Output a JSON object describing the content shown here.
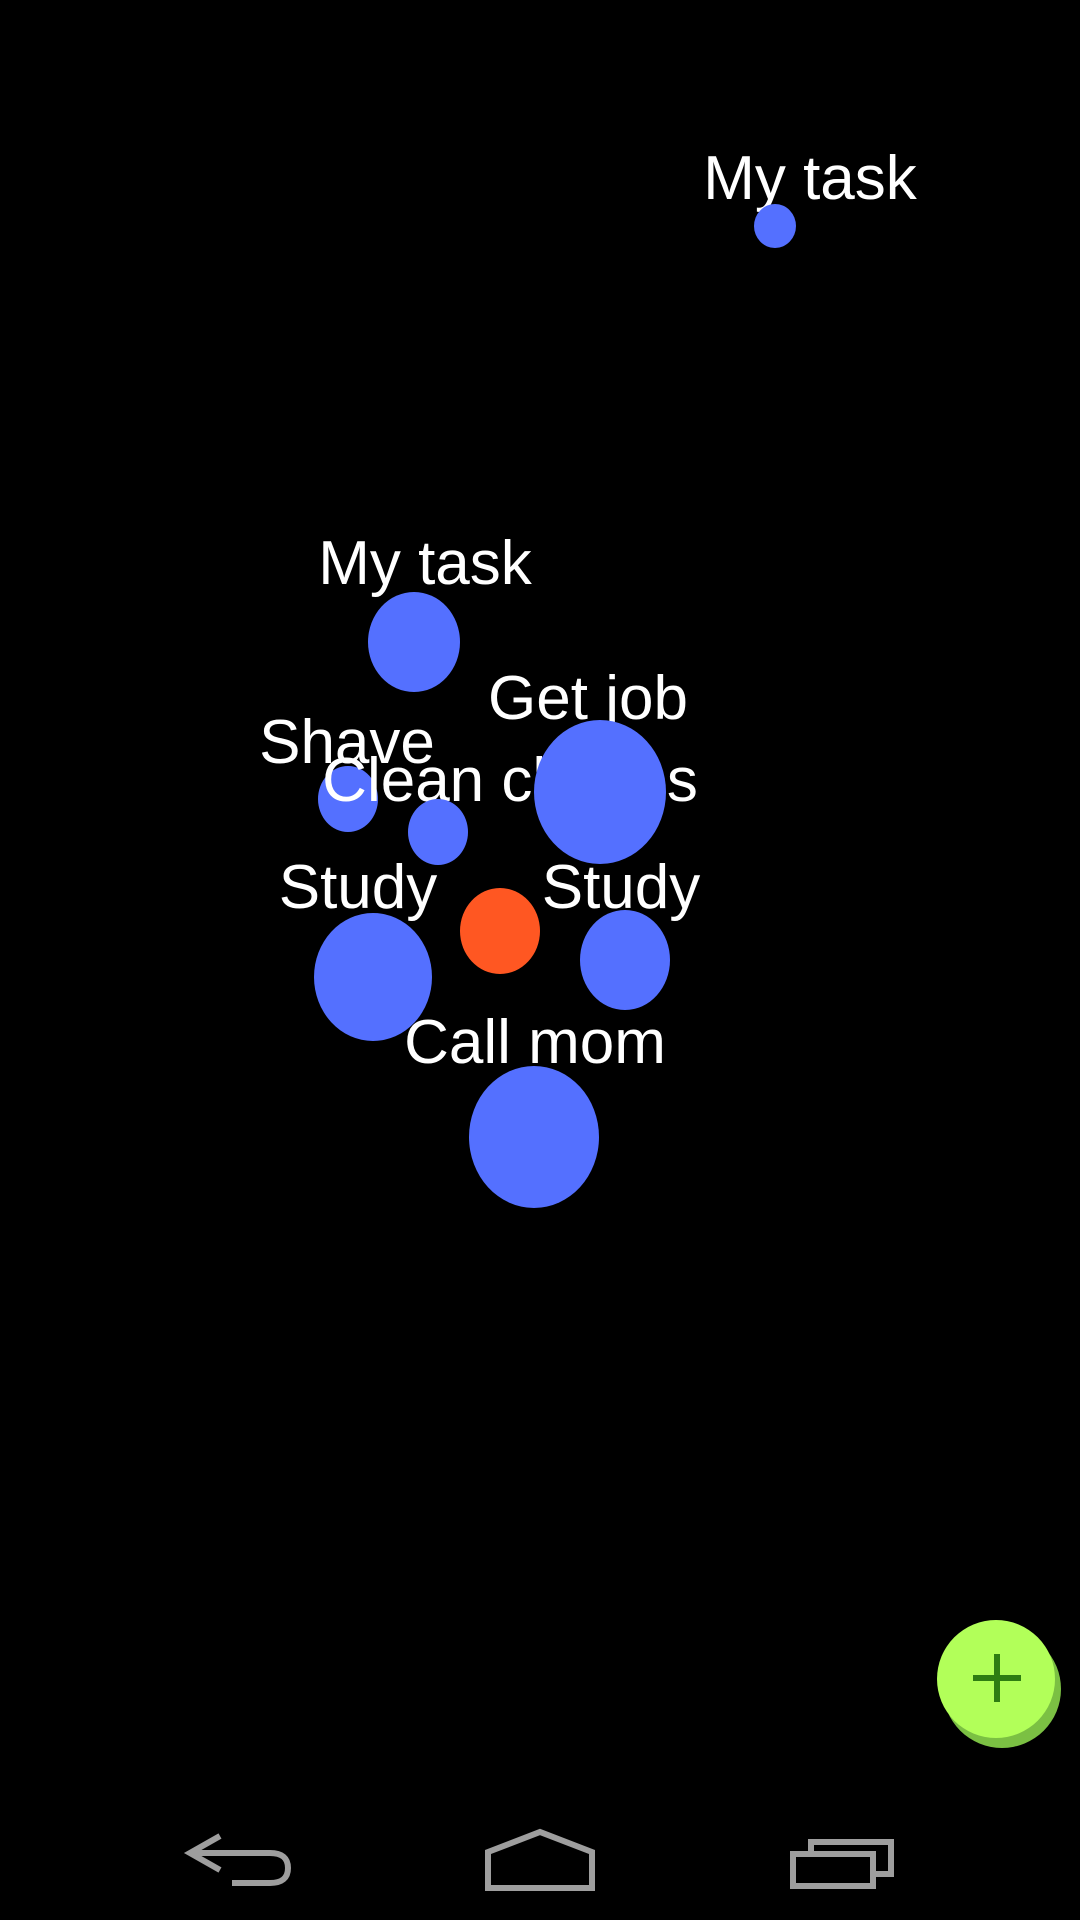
{
  "colors": {
    "background": "#000000",
    "task_dot": "#5470ff",
    "center_dot": "#ff5722",
    "fab": "#b2ff59",
    "fab_icon": "#2e7d12",
    "nav_icon": "#9e9e9e"
  },
  "tasks": [
    {
      "label": "My task"
    },
    {
      "label": "My task"
    },
    {
      "label": "Get job"
    },
    {
      "label": "Shave"
    },
    {
      "label": "Clean clothes"
    },
    {
      "label": "Study"
    },
    {
      "label": "Study"
    },
    {
      "label": "Call mom"
    }
  ],
  "fab": {
    "icon": "plus-icon"
  },
  "navbar": {
    "back_icon": "back-icon",
    "home_icon": "home-icon",
    "recents_icon": "recents-icon"
  }
}
